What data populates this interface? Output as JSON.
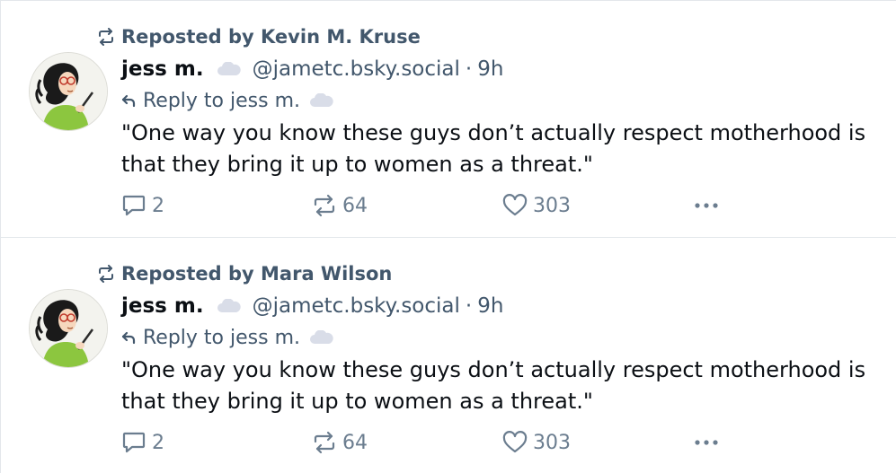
{
  "posts": [
    {
      "repost_label": "Reposted by Kevin M. Kruse",
      "author": {
        "display_name": "jess m.",
        "handle": "@jametc.bsky.social",
        "time": "9h"
      },
      "reply_to": "Reply to jess m.",
      "text": "\"One way you know these guys don’t actually respect motherhood is that they bring it up to women as a threat.\"",
      "counts": {
        "replies": "2",
        "reposts": "64",
        "likes": "303"
      }
    },
    {
      "repost_label": "Reposted by Mara Wilson",
      "author": {
        "display_name": "jess m.",
        "handle": "@jametc.bsky.social",
        "time": "9h"
      },
      "reply_to": "Reply to jess m.",
      "text": "\"One way you know these guys don’t actually respect motherhood is that they bring it up to women as a threat.\"",
      "counts": {
        "replies": "2",
        "reposts": "64",
        "likes": "303"
      }
    }
  ],
  "separator": "·",
  "icons": {
    "repost": "repost-icon",
    "cloud": "cloud-icon",
    "reply_arrow": "reply-arrow-icon",
    "comment": "comment-icon",
    "like": "heart-icon",
    "more": "more-options-icon"
  },
  "colors": {
    "text": "#0b0f14",
    "muted": "#42576c",
    "action": "#6b7d8f",
    "divider": "#e3e7eb"
  }
}
